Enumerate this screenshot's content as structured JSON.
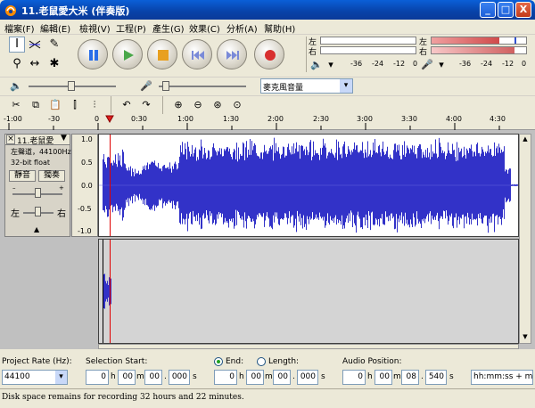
{
  "window": {
    "title": "11.老鼠愛大米 (伴奏版)",
    "minimize": "_",
    "maximize": "□",
    "close": "X"
  },
  "menu": [
    "檔案(F)",
    "編輯(E)",
    "檢視(V)",
    "工程(P)",
    "產生(G)",
    "效果(C)",
    "分析(A)",
    "幫助(H)"
  ],
  "meters": {
    "left": "左",
    "right": "右",
    "ticks": [
      "-36",
      "-24",
      "-12",
      "0"
    ]
  },
  "mixer": {
    "input_source": "麥克風音量"
  },
  "ruler": [
    "-1:00",
    "-30",
    "0",
    "0:30",
    "1:00",
    "1:30",
    "2:00",
    "2:30",
    "3:00",
    "3:30",
    "4:00",
    "4:30"
  ],
  "track": {
    "name": "11.老鼠愛",
    "channel_info": "左聲道，44100Hz",
    "format": "32-bit float",
    "mute": "靜音",
    "solo": "獨奏",
    "pan_left": "左",
    "pan_right": "右",
    "scale": [
      "1.0",
      "0.5",
      "0.0",
      "-0.5",
      "-1.0"
    ]
  },
  "selection": {
    "project_rate_label": "Project Rate (Hz):",
    "project_rate": "44100",
    "sel_start_label": "Selection Start:",
    "end_label": "End:",
    "length_label": "Length:",
    "audio_pos_label": "Audio Position:",
    "start": [
      "0",
      "00",
      "00",
      "000"
    ],
    "end": [
      "0",
      "00",
      "00",
      "000"
    ],
    "pos": [
      "0",
      "00",
      "08",
      "540"
    ],
    "units": [
      "h",
      "m",
      ".",
      "s"
    ],
    "format": "hh:mm:ss + milliseconds"
  },
  "status": "Disk space remains for recording 32 hours and 22 minutes.",
  "colors": {
    "wave": "#3232c8",
    "titlebar": "#0842a8",
    "cursor": "#e00000",
    "meter_fill": "#d04a4a"
  }
}
